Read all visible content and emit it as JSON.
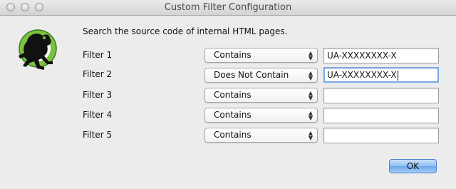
{
  "window": {
    "title": "Custom Filter Configuration"
  },
  "description": "Search the source code of internal HTML pages.",
  "filters": [
    {
      "label": "Filter 1",
      "mode": "Contains",
      "value": "UA-XXXXXXXX-X"
    },
    {
      "label": "Filter 2",
      "mode": "Does Not Contain",
      "value": "UA-XXXXXXXX-X"
    },
    {
      "label": "Filter 3",
      "mode": "Contains",
      "value": ""
    },
    {
      "label": "Filter 4",
      "mode": "Contains",
      "value": ""
    },
    {
      "label": "Filter 5",
      "mode": "Contains",
      "value": ""
    }
  ],
  "ok_label": "OK",
  "icons": {
    "logo": "screaming-frog-logo",
    "select_arrows": "updown-arrows-icon"
  },
  "colors": {
    "logo_green": "#7bc142",
    "focus_ring": "#7aa7e5",
    "ok_button": "#6aa7ec"
  }
}
